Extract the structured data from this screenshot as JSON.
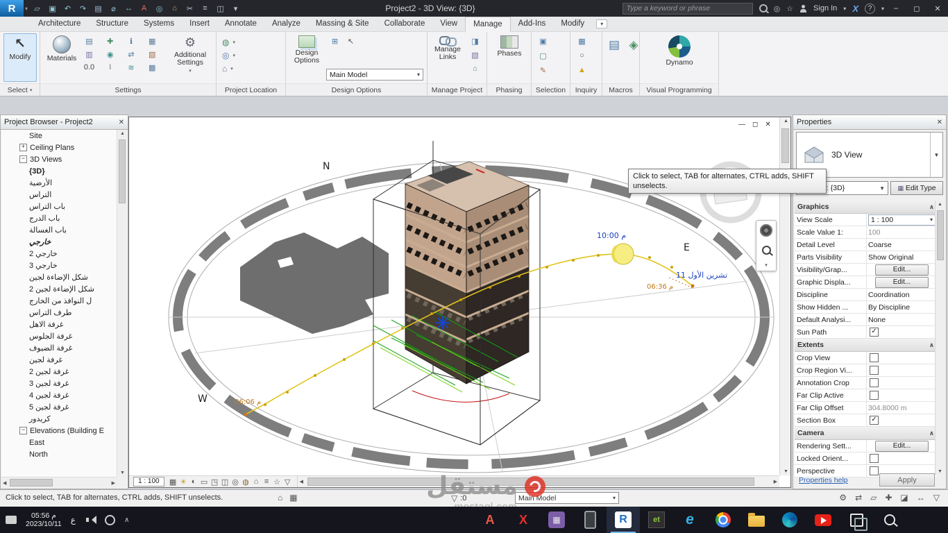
{
  "titlebar": {
    "app_button_label": "R",
    "title": "Project2 - 3D View: {3D}",
    "search_placeholder": "Type a keyword or phrase",
    "sign_in_label": "Sign In",
    "help_label": "?",
    "qat": [
      {
        "name": "open",
        "glyph": "▱",
        "color": "#8fc3cf"
      },
      {
        "name": "save",
        "glyph": "▣",
        "color": "#8fc3cf"
      },
      {
        "name": "undo",
        "glyph": "↶",
        "color": "#8fc3cf"
      },
      {
        "name": "redo",
        "glyph": "↷",
        "color": "#8fc3cf"
      },
      {
        "name": "print",
        "glyph": "▤",
        "color": "#9fb6c8"
      },
      {
        "name": "measure",
        "glyph": "⌀",
        "color": "#8fc3cf"
      },
      {
        "name": "aligned-dimension",
        "glyph": "↔",
        "color": "#8fc3cf"
      },
      {
        "name": "text",
        "glyph": "A",
        "color": "#e26a5a"
      },
      {
        "name": "tag-by-category",
        "glyph": "◎",
        "color": "#8fc3cf"
      },
      {
        "name": "default-3d-view",
        "glyph": "⌂",
        "color": "#cfae72"
      },
      {
        "name": "section",
        "glyph": "✂",
        "color": "#b9c3cc"
      },
      {
        "name": "thin-lines",
        "glyph": "≡",
        "color": "#b9c3cc"
      },
      {
        "name": "switch-windows",
        "glyph": "◫",
        "color": "#b9c3cc"
      },
      {
        "name": "customize-quick-access-toolbar",
        "glyph": "▾",
        "color": "#b9c3cc"
      }
    ]
  },
  "ribbon": {
    "tabs": [
      "Architecture",
      "Structure",
      "Systems",
      "Insert",
      "Annotate",
      "Analyze",
      "Massing & Site",
      "Collaborate",
      "View",
      "Manage",
      "Add-Ins",
      "Modify"
    ],
    "active_tab": "Manage",
    "select": {
      "modify_label": "Modify",
      "panel_label": "Select"
    },
    "settings": {
      "materials_label": "Materials",
      "additional_settings_label": "Additional Settings",
      "panel_label": "Settings",
      "icons": [
        {
          "name": "object-styles",
          "glyph": "▤",
          "color": "#5a7d9e"
        },
        {
          "name": "snaps",
          "glyph": "✚",
          "color": "#4c8f62"
        },
        {
          "name": "project-information",
          "glyph": "ℹ",
          "color": "#4f7ba6"
        },
        {
          "name": "project-parameters",
          "glyph": "▦",
          "color": "#5a7d9e"
        },
        {
          "name": "shared-parameters",
          "glyph": "▥",
          "color": "#7a6fa0"
        },
        {
          "name": "global-parameters",
          "glyph": "◉",
          "color": "#3f8f8f"
        },
        {
          "name": "transfer-project-standards",
          "glyph": "⇄",
          "color": "#4f7ba6"
        },
        {
          "name": "purge-unused",
          "glyph": "▧",
          "color": "#a06a4a"
        },
        {
          "name": "project-units",
          "glyph": "0.0",
          "color": "#444444"
        },
        {
          "name": "structural-settings",
          "glyph": "I",
          "color": "#777777"
        },
        {
          "name": "mep-settings",
          "glyph": "≋",
          "color": "#3f8f8f"
        },
        {
          "name": "panel-schedule-templates",
          "glyph": "▩",
          "color": "#5a7d9e"
        }
      ]
    },
    "project_location": {
      "panel_label": "Project Location",
      "icons": [
        {
          "name": "location",
          "glyph": "◍",
          "color": "#4c8f62"
        },
        {
          "name": "coordinates",
          "glyph": "◎",
          "color": "#4f7ba6"
        },
        {
          "name": "position",
          "glyph": "⌂",
          "color": "#7a6fa0"
        }
      ]
    },
    "design_options": {
      "button_label": "Design Options",
      "combo_value": "Main Model",
      "panel_label": "Design Options",
      "side_icons": [
        {
          "name": "add-to-set",
          "glyph": "⊞",
          "color": "#4f7ba6"
        },
        {
          "name": "pick-to-edit",
          "glyph": "↖",
          "color": "#555555"
        }
      ]
    },
    "manage_project": {
      "manage_links_label": "Manage Links",
      "panel_label": "Manage Project",
      "side_icons": [
        {
          "name": "manage-images",
          "glyph": "◨",
          "color": "#4f7ba6"
        },
        {
          "name": "decal-types",
          "glyph": "▧",
          "color": "#7a6fa0"
        },
        {
          "name": "starting-view",
          "glyph": "⌂",
          "color": "#4c8f62"
        }
      ]
    },
    "phasing": {
      "phases_label": "Phases",
      "panel_label": "Phasing"
    },
    "selection": {
      "panel_label": "Selection",
      "icons": [
        {
          "name": "save-selection",
          "glyph": "▣",
          "color": "#4f7ba6"
        },
        {
          "name": "load-selection",
          "glyph": "▢",
          "color": "#4c8f62"
        },
        {
          "name": "edit-selection",
          "glyph": "✎",
          "color": "#a06a4a"
        }
      ]
    },
    "inquiry": {
      "panel_label": "Inquiry",
      "icons": [
        {
          "name": "ids-of-selection",
          "glyph": "▦",
          "color": "#4f7ba6"
        },
        {
          "name": "select-by-id",
          "glyph": "○",
          "color": "#555555"
        },
        {
          "name": "warnings",
          "glyph": "▲",
          "color": "#d8a012"
        }
      ]
    },
    "macros": {
      "panel_label": "Macros",
      "icons": [
        {
          "name": "macro-manager",
          "glyph": "▤",
          "color": "#4f7ba6"
        },
        {
          "name": "macro-security",
          "glyph": "◈",
          "color": "#4c8f62"
        }
      ]
    },
    "visual_programming": {
      "dynamo_label": "Dynamo",
      "panel_label": "Visual Programming"
    }
  },
  "project_browser": {
    "title": "Project Browser - Project2",
    "items": [
      {
        "label": "Site",
        "indent": 2,
        "node": "leaf"
      },
      {
        "label": "Ceiling Plans",
        "indent": 1,
        "node": "plus"
      },
      {
        "label": "3D Views",
        "indent": 1,
        "node": "minus"
      },
      {
        "label": "{3D}",
        "indent": 2,
        "node": "leaf",
        "bold": true
      },
      {
        "label": "الأرضية",
        "indent": 2,
        "node": "leaf"
      },
      {
        "label": "التراس",
        "indent": 2,
        "node": "leaf"
      },
      {
        "label": "باب التراس",
        "indent": 2,
        "node": "leaf"
      },
      {
        "label": "باب الدرج",
        "indent": 2,
        "node": "leaf"
      },
      {
        "label": "باب الغسالة",
        "indent": 2,
        "node": "leaf"
      },
      {
        "label": "خارجي",
        "indent": 2,
        "node": "leaf",
        "bold": true,
        "italic": true
      },
      {
        "label": "خارجي 2",
        "indent": 2,
        "node": "leaf"
      },
      {
        "label": "خارجي 3",
        "indent": 2,
        "node": "leaf"
      },
      {
        "label": "شكل الإضاءة لجين",
        "indent": 2,
        "node": "leaf"
      },
      {
        "label": "شكل الإضاءة لجين 2",
        "indent": 2,
        "node": "leaf"
      },
      {
        "label": "ل النوافذ من الخارج",
        "indent": 2,
        "node": "leaf"
      },
      {
        "label": "طرف التراس",
        "indent": 2,
        "node": "leaf"
      },
      {
        "label": "غرفة الاهل",
        "indent": 2,
        "node": "leaf"
      },
      {
        "label": "غرفة الجلوس",
        "indent": 2,
        "node": "leaf"
      },
      {
        "label": "غرفة الضيوف",
        "indent": 2,
        "node": "leaf"
      },
      {
        "label": "غرفة لجين",
        "indent": 2,
        "node": "leaf"
      },
      {
        "label": "غرفة لجين 2",
        "indent": 2,
        "node": "leaf"
      },
      {
        "label": "غرفة لجين 3",
        "indent": 2,
        "node": "leaf"
      },
      {
        "label": "غرفة لجين 4",
        "indent": 2,
        "node": "leaf"
      },
      {
        "label": "غرفة لجين 5",
        "indent": 2,
        "node": "leaf"
      },
      {
        "label": "كريدور",
        "indent": 2,
        "node": "leaf"
      },
      {
        "label": "Elevations (Building E",
        "indent": 1,
        "node": "minus"
      },
      {
        "label": "East",
        "indent": 2,
        "node": "leaf"
      },
      {
        "label": "North",
        "indent": 2,
        "node": "leaf"
      }
    ]
  },
  "viewport": {
    "tooltip": "Click to select, TAB for alternates, CTRL adds, SHIFT unselects.",
    "compass": {
      "n": "N",
      "e": "E",
      "w": "W"
    },
    "sun_time": "10:00 م",
    "date_label": "تشرين الأول 11",
    "time_east": "06:36 م",
    "time_west": "06:06 م",
    "scale_label": "1 : 100",
    "view_bar_icons": [
      {
        "name": "visual-style",
        "glyph": "▦",
        "color": "#555555"
      },
      {
        "name": "sun-path",
        "glyph": "☀",
        "color": "#c9a227"
      },
      {
        "name": "shadows",
        "glyph": "◐",
        "color": "#555555"
      },
      {
        "name": "show-rendering-dialog",
        "glyph": "▭",
        "color": "#555555"
      },
      {
        "name": "crop-view",
        "glyph": "◳",
        "color": "#555555"
      },
      {
        "name": "show-crop-region",
        "glyph": "◫",
        "color": "#555555"
      },
      {
        "name": "temporary-hide-isolate",
        "glyph": "◎",
        "color": "#555555"
      },
      {
        "name": "reveal-hidden-elements",
        "glyph": "◍",
        "color": "#8a6a2f"
      },
      {
        "name": "unlocked-view",
        "glyph": "⌂",
        "color": "#555555"
      },
      {
        "name": "temporary-view-properties",
        "glyph": "≡",
        "color": "#555555"
      },
      {
        "name": "worksharing-display",
        "glyph": "☆",
        "color": "#555555"
      },
      {
        "name": "analysis-display",
        "glyph": "▽",
        "color": "#555555"
      }
    ]
  },
  "properties": {
    "title": "Properties",
    "type_label": "3D View",
    "instance_selector": "3D View: {3D}",
    "edit_type_label": "Edit Type",
    "help_link": "Properties help",
    "apply_label": "Apply",
    "rows": [
      {
        "kind": "section",
        "label": "Graphics"
      },
      {
        "kind": "row",
        "label": "View Scale",
        "value": "1 : 100",
        "control": "dropdown"
      },
      {
        "kind": "row",
        "label": "Scale Value    1:",
        "value": "100",
        "gray": true
      },
      {
        "kind": "row",
        "label": "Detail Level",
        "value": "Coarse"
      },
      {
        "kind": "row",
        "label": "Parts Visibility",
        "value": "Show Original"
      },
      {
        "kind": "row",
        "label": "Visibility/Grap...",
        "value": "Edit...",
        "control": "button"
      },
      {
        "kind": "row",
        "label": "Graphic Displa...",
        "value": "Edit...",
        "control": "button"
      },
      {
        "kind": "row",
        "label": "Discipline",
        "value": "Coordination"
      },
      {
        "kind": "row",
        "label": "Show Hidden ...",
        "value": "By Discipline"
      },
      {
        "kind": "row",
        "label": "Default Analysi...",
        "value": "None"
      },
      {
        "kind": "row",
        "label": "Sun Path",
        "control": "checkbox",
        "checked": true
      },
      {
        "kind": "section",
        "label": "Extents"
      },
      {
        "kind": "row",
        "label": "Crop View",
        "control": "checkbox",
        "checked": false
      },
      {
        "kind": "row",
        "label": "Crop Region Vi...",
        "control": "checkbox",
        "checked": false
      },
      {
        "kind": "row",
        "label": "Annotation Crop",
        "control": "checkbox",
        "checked": false
      },
      {
        "kind": "row",
        "label": "Far Clip Active",
        "control": "checkbox",
        "checked": false
      },
      {
        "kind": "row",
        "label": "Far Clip Offset",
        "value": "304.8000 m",
        "gray": true
      },
      {
        "kind": "row",
        "label": "Section Box",
        "control": "checkbox",
        "checked": true
      },
      {
        "kind": "section",
        "label": "Camera"
      },
      {
        "kind": "row",
        "label": "Rendering Sett...",
        "value": "Edit...",
        "control": "button"
      },
      {
        "kind": "row",
        "label": "Locked Orient...",
        "control": "checkbox",
        "checked": false
      },
      {
        "kind": "row",
        "label": "Perspective",
        "control": "checkbox",
        "checked": false
      }
    ]
  },
  "statusbar": {
    "message": "Click to select, TAB for alternates, CTRL adds, SHIFT unselects.",
    "selection_count": ":0",
    "design_option_combo": "Main Model",
    "left_icons": [
      {
        "name": "worksets",
        "glyph": "⌂",
        "color": "#555555"
      },
      {
        "name": "design-options-status",
        "glyph": "▦",
        "color": "#555555"
      }
    ],
    "right_icons": [
      {
        "name": "background-processes",
        "glyph": "⚙",
        "color": "#555555"
      },
      {
        "name": "select-links",
        "glyph": "⇄",
        "color": "#555555"
      },
      {
        "name": "select-underlay",
        "glyph": "▱",
        "color": "#555555"
      },
      {
        "name": "select-pinned",
        "glyph": "✚",
        "color": "#555555"
      },
      {
        "name": "select-by-face",
        "glyph": "◪",
        "color": "#555555"
      },
      {
        "name": "drag-on-selection",
        "glyph": "↔",
        "color": "#555555"
      },
      {
        "name": "filter",
        "glyph": "▽",
        "color": "#555555"
      }
    ]
  },
  "taskbar": {
    "time": "05:56 م",
    "date": "2023/10/11",
    "language": "ع",
    "apps": [
      {
        "name": "autocad",
        "label": "A"
      },
      {
        "name": "xforce",
        "label": "X"
      },
      {
        "name": "keygen",
        "label": "▦"
      },
      {
        "name": "phone"
      },
      {
        "name": "revit",
        "label": "R",
        "active": true
      },
      {
        "name": "etabs",
        "label": "et"
      },
      {
        "name": "internet-explorer",
        "label": "e"
      },
      {
        "name": "chrome"
      },
      {
        "name": "file-explorer"
      },
      {
        "name": "edge"
      },
      {
        "name": "youtube"
      },
      {
        "name": "task-view"
      },
      {
        "name": "search"
      },
      {
        "name": "start"
      }
    ]
  },
  "watermark": {
    "brand": "مستقل",
    "domain": "mostaql.com"
  }
}
